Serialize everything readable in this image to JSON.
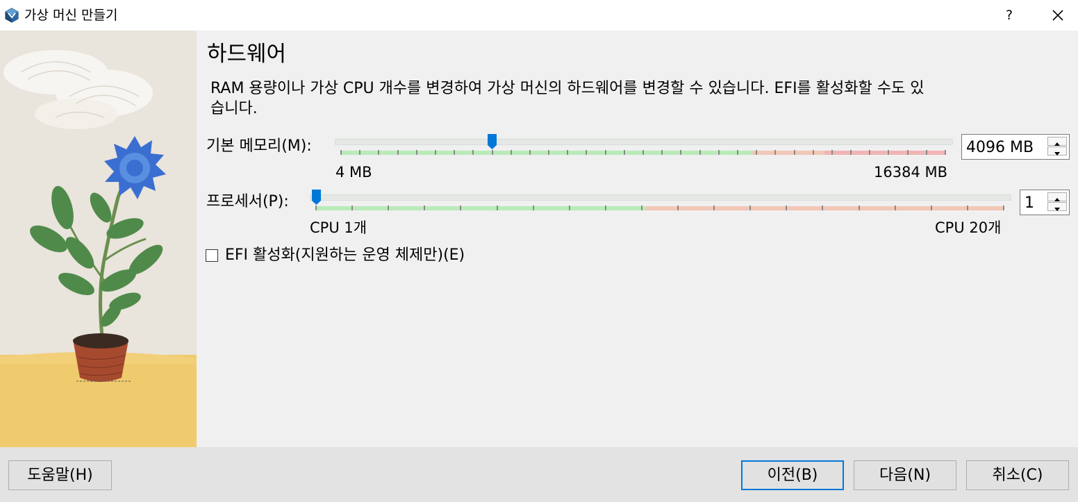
{
  "window": {
    "title": "가상 머신 만들기",
    "help_label": "?",
    "app_icon": "virtualbox-cube-icon",
    "close_icon": "close-x-icon"
  },
  "page": {
    "title": "하드웨어",
    "description": "RAM 용량이나 가상 CPU 개수를 변경하여 가상 머신의 하드웨어를 변경할 수 있습니다. EFI를 활성화할 수도 있습니다."
  },
  "memory": {
    "label": "기본 메모리(M):",
    "min_label": "4 MB",
    "max_label": "16384 MB",
    "value_display": "4096 MB",
    "value_mb": 4096,
    "min_mb": 4,
    "max_mb": 16384,
    "green_until_fraction": 0.68,
    "orange_until_fraction": 0.8
  },
  "processor": {
    "label": "프로세서(P):",
    "min_label": "CPU 1개",
    "max_label": "CPU 20개",
    "value_display": "1",
    "value": 1,
    "min": 1,
    "max": 20,
    "green_until_fraction": 0.48
  },
  "efi": {
    "label": "EFI 활성화(지원하는 운영 체제만)(E)",
    "checked": false
  },
  "buttons": {
    "help": "도움말(H)",
    "back": "이전(B)",
    "next": "다음(N)",
    "cancel": "취소(C)"
  },
  "colors": {
    "slider_green": "#b9ebb9",
    "slider_orange": "#f2c7b6",
    "slider_red": "#f1b4b4",
    "thumb_blue": "#0078d7",
    "default_button_border": "#0078d7"
  }
}
